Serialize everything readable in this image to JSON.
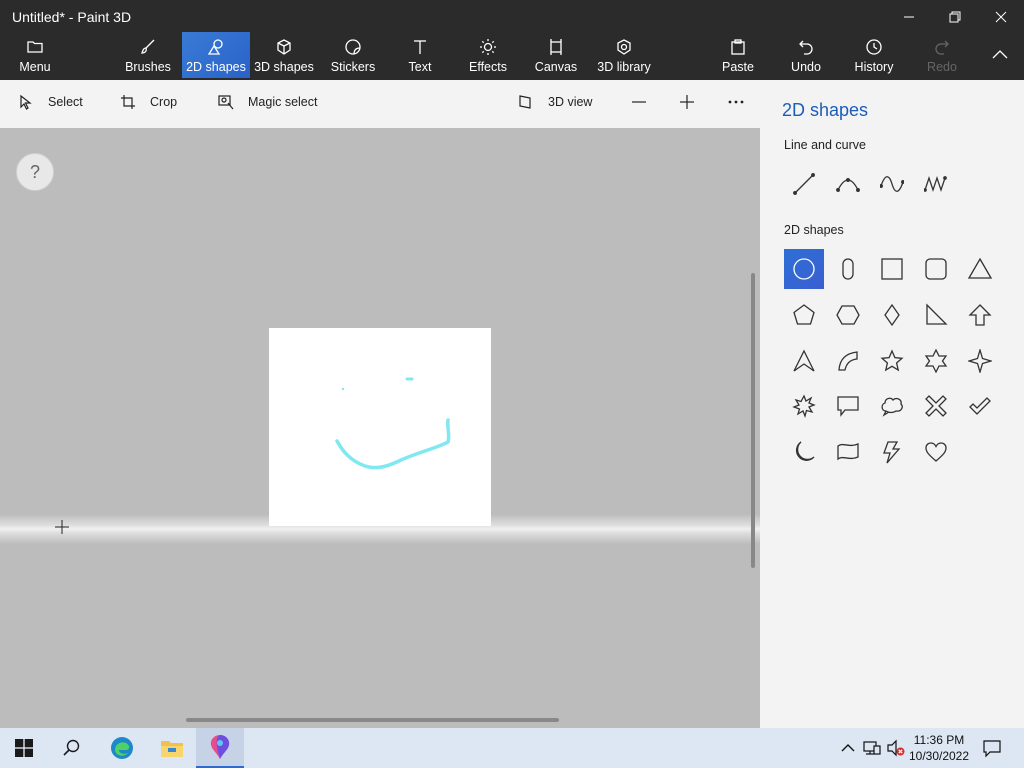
{
  "window": {
    "title": "Untitled* - Paint 3D"
  },
  "ribbon": {
    "menu": "Menu",
    "tabs": [
      {
        "label": "Brushes"
      },
      {
        "label": "2D shapes"
      },
      {
        "label": "3D shapes"
      },
      {
        "label": "Stickers"
      },
      {
        "label": "Text"
      },
      {
        "label": "Effects"
      },
      {
        "label": "Canvas"
      },
      {
        "label": "3D library"
      }
    ],
    "actions": [
      {
        "label": "Paste"
      },
      {
        "label": "Undo"
      },
      {
        "label": "History"
      },
      {
        "label": "Redo"
      }
    ]
  },
  "toolbar": {
    "select": "Select",
    "crop": "Crop",
    "magic_select": "Magic select",
    "view3d": "3D view"
  },
  "workspace": {
    "help": "?"
  },
  "panel": {
    "title": "2D shapes",
    "line_section": "Line and curve",
    "shapes_section": "2D shapes"
  },
  "taskbar": {
    "time": "11:36 PM",
    "date": "10/30/2022"
  },
  "colors": {
    "accent": "#2d6fd6",
    "drawing_stroke": "#7fe8f0"
  }
}
